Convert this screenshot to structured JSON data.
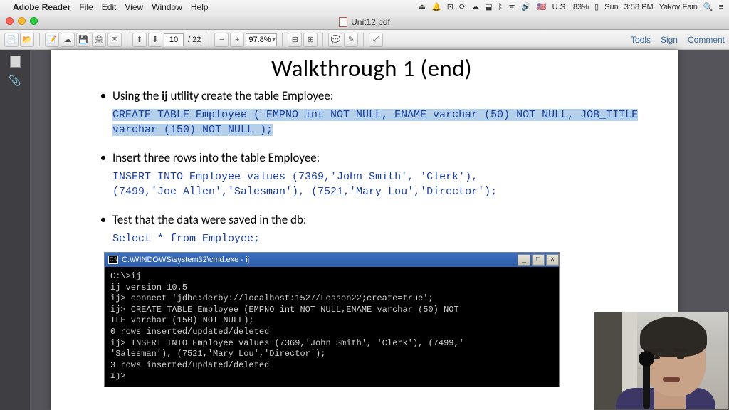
{
  "menubar": {
    "app": "Adobe Reader",
    "items": [
      "File",
      "Edit",
      "View",
      "Window",
      "Help"
    ],
    "right": {
      "flag": "🇺🇸",
      "locale": "U.S.",
      "battery": "83%",
      "batt_icon": "▯",
      "day": "Sun",
      "time": "3:58 PM",
      "user": "Yakov Fain"
    }
  },
  "titlebar": {
    "filename": "Unit12.pdf"
  },
  "toolbar": {
    "page_current": "10",
    "page_total": "/ 22",
    "zoom": "97.8%",
    "right": {
      "tools": "Tools",
      "sign": "Sign",
      "comment": "Comment"
    }
  },
  "doc": {
    "title": "Walkthrough 1 (end)",
    "bullets": [
      {
        "pre": "Using the ",
        "bold": "ij",
        "post": " utility create the table Employee:"
      },
      {
        "text": "Insert three rows into the table Employee:"
      },
      {
        "text": "Test that the data were saved in the db:"
      }
    ],
    "code1": "CREATE TABLE Employee ( EMPNO int NOT NULL, ENAME varchar (50)\nNOT NULL, JOB_TITLE varchar (150) NOT NULL );",
    "code2": "INSERT INTO Employee values (7369,'John Smith', 'Clerk'),\n(7499,'Joe Allen','Salesman'), (7521,'Mary Lou','Director');",
    "code3": "Select * from Employee;"
  },
  "cmd": {
    "title": "C:\\WINDOWS\\system32\\cmd.exe - ij",
    "body": "C:\\>ij\nij version 10.5\nij> connect 'jdbc:derby://localhost:1527/Lesson22;create=true';\nij> CREATE TABLE Employee (EMPNO int NOT NULL,ENAME varchar (50) NOT \nTLE varchar (150) NOT NULL);\n0 rows inserted/updated/deleted\nij> INSERT INTO Employee values (7369,'John Smith', 'Clerk'), (7499,'\n'Salesman'), (7521,'Mary Lou','Director');\n3 rows inserted/updated/deleted\nij>"
  }
}
